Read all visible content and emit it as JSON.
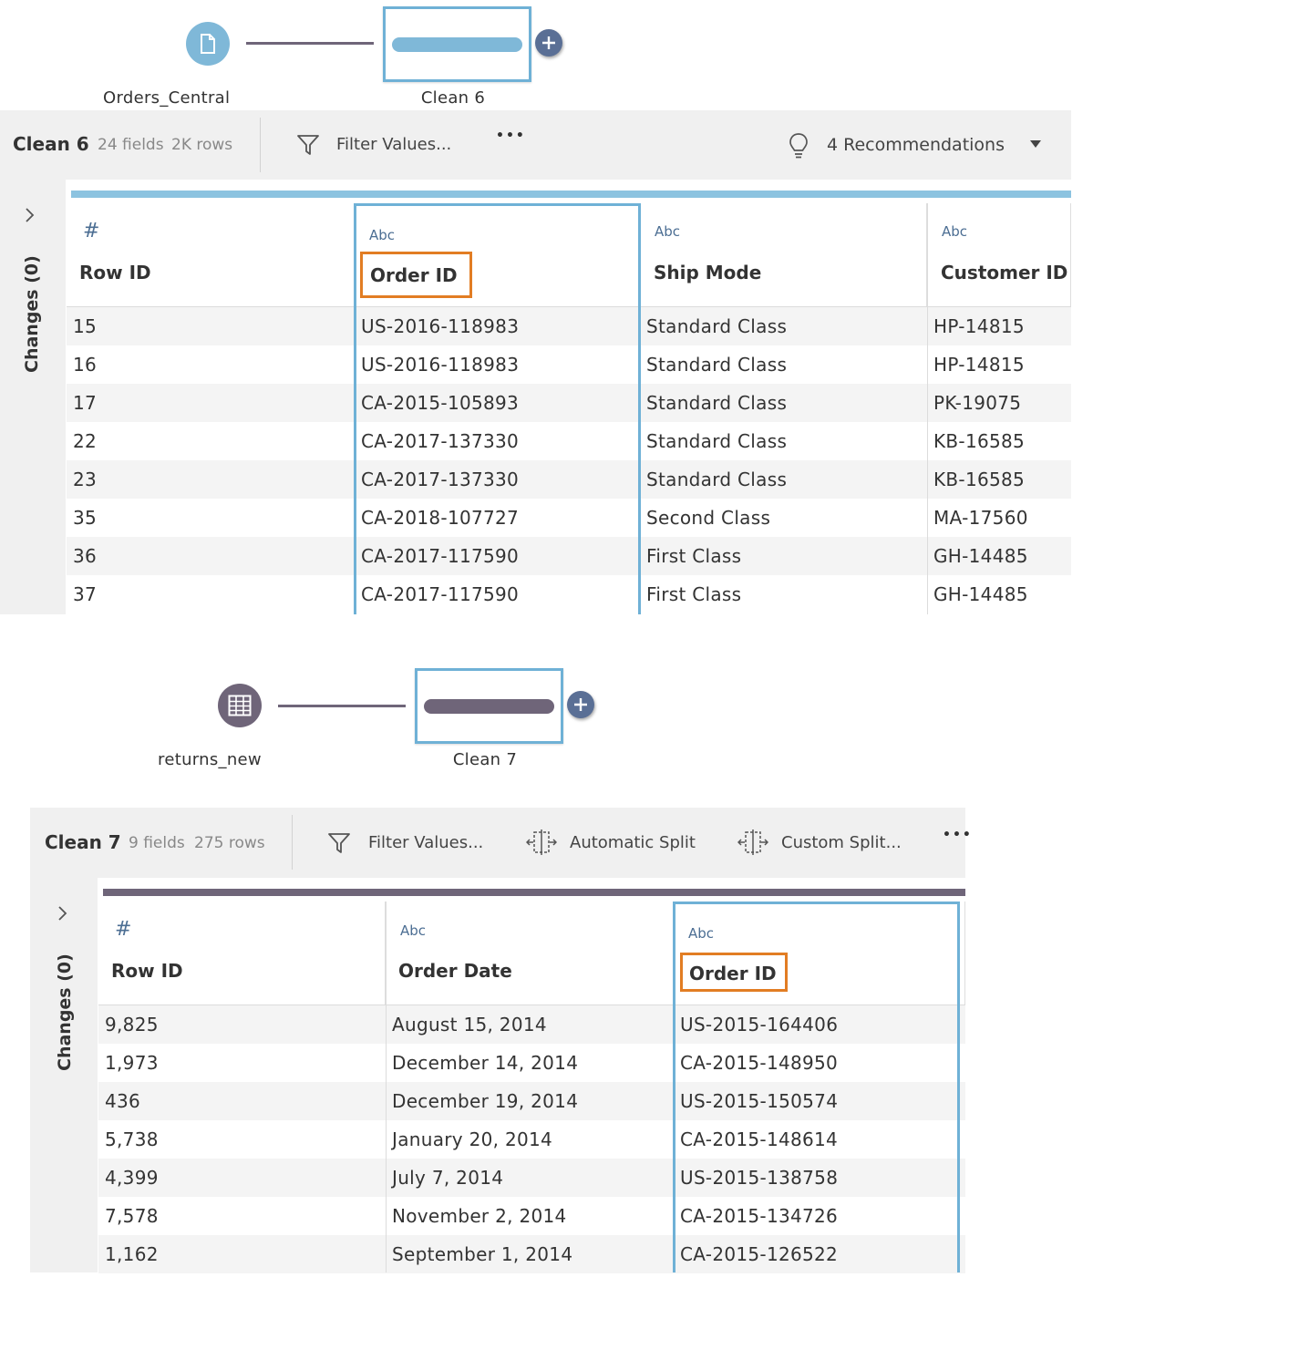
{
  "flow1": {
    "input_label": "Orders_Central",
    "step_label": "Clean 6",
    "input_icon": "file-icon",
    "accent": "#7fb8d8"
  },
  "panel1": {
    "title": "Clean 6",
    "fields": "24 fields",
    "rows": "2K rows",
    "filter_label": "Filter Values...",
    "more_label": "•••",
    "recommendations_label": "4 Recommendations",
    "changes_label": "Changes (0)",
    "columns": [
      {
        "type": "#",
        "name": "Row ID"
      },
      {
        "type": "Abc",
        "name": "Order ID"
      },
      {
        "type": "Abc",
        "name": "Ship Mode"
      },
      {
        "type": "Abc",
        "name": "Customer ID"
      }
    ],
    "rows_data": [
      [
        "15",
        "US-2016-118983",
        "Standard Class",
        "HP-14815"
      ],
      [
        "16",
        "US-2016-118983",
        "Standard Class",
        "HP-14815"
      ],
      [
        "17",
        "CA-2015-105893",
        "Standard Class",
        "PK-19075"
      ],
      [
        "22",
        "CA-2017-137330",
        "Standard Class",
        "KB-16585"
      ],
      [
        "23",
        "CA-2017-137330",
        "Standard Class",
        "KB-16585"
      ],
      [
        "35",
        "CA-2018-107727",
        "Second Class",
        "MA-17560"
      ],
      [
        "36",
        "CA-2017-117590",
        "First Class",
        "GH-14485"
      ],
      [
        "37",
        "CA-2017-117590",
        "First Class",
        "GH-14485"
      ]
    ]
  },
  "flow2": {
    "input_label": "returns_new",
    "step_label": "Clean 7",
    "input_icon": "table-icon",
    "accent": "#6f6579"
  },
  "panel2": {
    "title": "Clean 7",
    "fields": "9 fields",
    "rows": "275 rows",
    "filter_label": "Filter Values...",
    "auto_split_label": "Automatic Split",
    "custom_split_label": "Custom Split...",
    "more_label": "•••",
    "changes_label": "Changes (0)",
    "columns": [
      {
        "type": "#",
        "name": "Row ID"
      },
      {
        "type": "Abc",
        "name": "Order Date"
      },
      {
        "type": "Abc",
        "name": "Order ID"
      }
    ],
    "rows_data": [
      [
        "9,825",
        "August 15, 2014",
        "US-2015-164406"
      ],
      [
        "1,973",
        "December 14, 2014",
        "CA-2015-148950"
      ],
      [
        "436",
        "December 19, 2014",
        "US-2015-150574"
      ],
      [
        "5,738",
        "January 20, 2014",
        "CA-2015-148614"
      ],
      [
        "4,399",
        "July 7, 2014",
        "US-2015-138758"
      ],
      [
        "7,578",
        "November 2, 2014",
        "CA-2015-134726"
      ],
      [
        "1,162",
        "September 1, 2014",
        "CA-2015-126522"
      ]
    ]
  },
  "colors": {
    "selection": "#6fb1d6",
    "highlight": "#e27d23",
    "type_icon": "#4c6e93"
  }
}
